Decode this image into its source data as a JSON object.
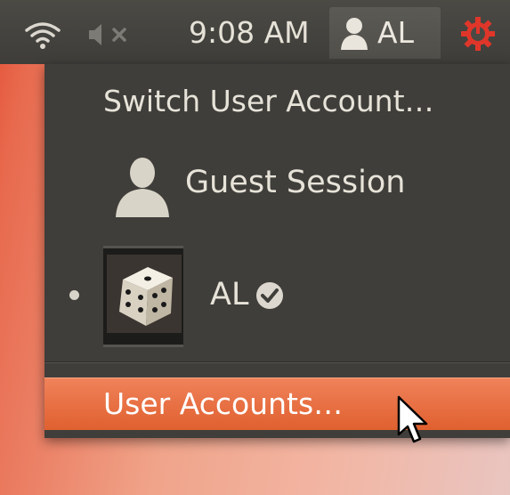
{
  "panel": {
    "clock": "9:08 AM",
    "user_name": "AL",
    "icons": [
      "wifi-icon",
      "mute-icon",
      "user-icon",
      "power-gear-icon"
    ],
    "accent": "#e0602f"
  },
  "menu": {
    "switch_label": "Switch User Account…",
    "guest_label": "Guest Session",
    "current_user_label": "AL",
    "accounts_label": "User Accounts…"
  }
}
